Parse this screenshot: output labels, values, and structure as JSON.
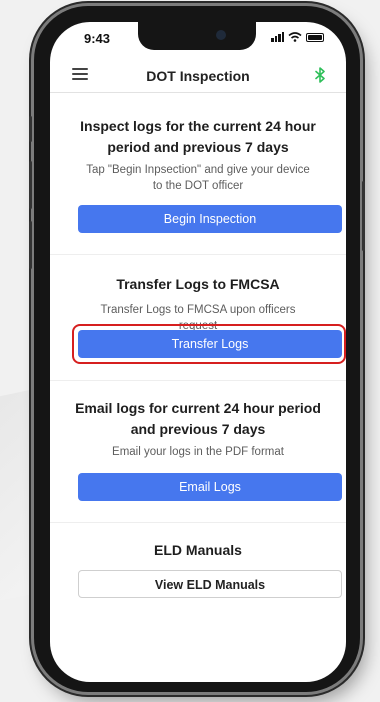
{
  "status_bar": {
    "time": "9:43"
  },
  "header": {
    "title": "DOT Inspection"
  },
  "sections": {
    "inspect": {
      "heading": "Inspect logs for the current 24 hour period and previous 7 days",
      "description": "Tap \"Begin Inpsection\" and give your device to the DOT officer",
      "button_label": "Begin Inspection"
    },
    "transfer": {
      "heading": "Transfer Logs to FMCSA",
      "description": "Transfer Logs to FMCSA upon officers request",
      "button_label": "Transfer Logs"
    },
    "email": {
      "heading": "Email logs for current 24 hour period and previous 7 days",
      "description": "Email your logs in the PDF format",
      "button_label": "Email Logs"
    },
    "manuals": {
      "heading": "ELD Manuals",
      "button_label": "View ELD Manuals"
    }
  },
  "colors": {
    "primary_button": "#4677ee",
    "highlight": "#d61f1f",
    "bluetooth": "#2fbf5a"
  },
  "icons": {
    "menu": "hamburger-menu-icon",
    "bluetooth": "bluetooth-icon",
    "signal": "cellular-signal-icon",
    "wifi": "wifi-icon",
    "battery": "battery-icon"
  }
}
